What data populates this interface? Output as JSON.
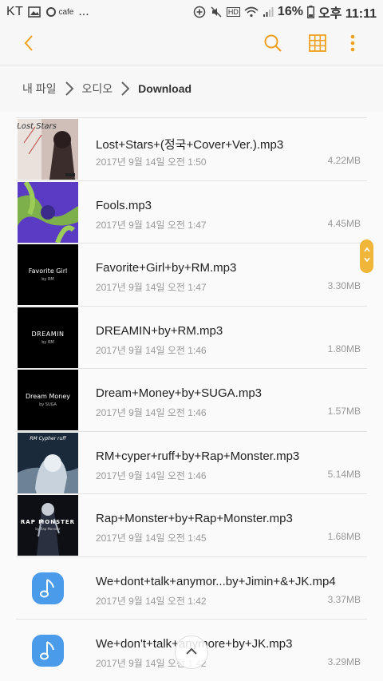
{
  "status": {
    "carrier": "KT",
    "cafe": "cafe",
    "more": "...",
    "hd": "HD",
    "battery": "16%",
    "time": "오후 11:11"
  },
  "toolbar": {
    "back_icon": "chevron-left-icon",
    "search_icon": "search-icon",
    "grid_icon": "grid-view-icon",
    "more_icon": "more-vert-icon",
    "accent": "#f0a020"
  },
  "breadcrumb": {
    "items": [
      "내 파일",
      "오디오",
      "Download"
    ]
  },
  "files": [
    {
      "name": "Lost+Stars+(정국+Cover+Ver.).mp3",
      "date": "2017년 9월 14일 오전 1:50",
      "size": "4.22MB",
      "thumb": "lost-stars-art"
    },
    {
      "name": "Fools.mp3",
      "date": "2017년 9월 14일 오전 1:47",
      "size": "4.45MB",
      "thumb": "fools-art"
    },
    {
      "name": "Favorite+Girl+by+RM.mp3",
      "date": "2017년 9월 14일 오전 1:47",
      "size": "3.30MB",
      "thumb": "favorite-girl-art",
      "art_text": "Favorite Girl",
      "art_sub": "by RM"
    },
    {
      "name": "DREAMIN+by+RM.mp3",
      "date": "2017년 9월 14일 오전 1:46",
      "size": "1.80MB",
      "thumb": "dreamin-art",
      "art_text": "DREAMIN",
      "art_sub": "by RM"
    },
    {
      "name": "Dream+Money+by+SUGA.mp3",
      "date": "2017년 9월 14일 오전 1:46",
      "size": "1.57MB",
      "thumb": "dream-money-art",
      "art_text": "Dream Money",
      "art_sub": "by SUGA"
    },
    {
      "name": "RM+cyper+ruff+by+Rap+Monster.mp3",
      "date": "2017년 9월 14일 오전 1:46",
      "size": "5.14MB",
      "thumb": "rm-cypher-art",
      "art_text": "RM Cypher ruff"
    },
    {
      "name": "Rap+Monster+by+Rap+Monster.mp3",
      "date": "2017년 9월 14일 오전 1:45",
      "size": "1.68MB",
      "thumb": "rap-monster-art",
      "art_text": "RAP MONSTER",
      "art_sub": "by Rap Monster"
    },
    {
      "name": "We+dont+talk+anymor...by+Jimin+&+JK.mp4",
      "date": "2017년 9월 14일 오전 1:42",
      "size": "3.37MB",
      "thumb": "music-note-icon"
    },
    {
      "name": "We+don't+talk+anymore+by+JK.mp3",
      "date": "2017년 9월 14일 오전 1:42",
      "size": "3.29MB",
      "thumb": "music-note-icon"
    }
  ],
  "lost_stars_art_text": "Lost Stars",
  "scroll": {
    "handle_icon": "fast-scroll-icon",
    "top_icon": "chevron-up-icon"
  }
}
